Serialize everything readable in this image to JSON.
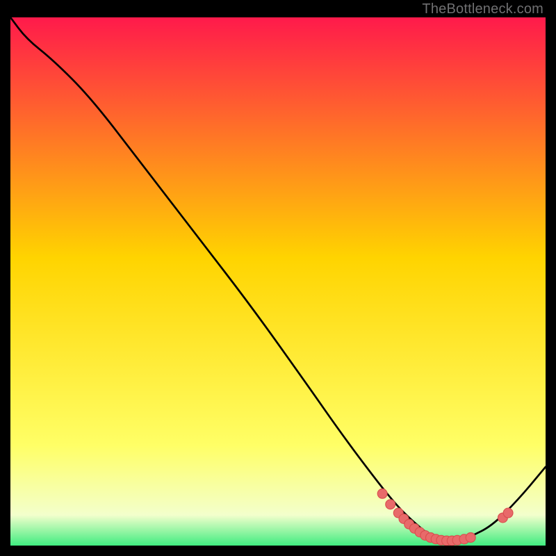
{
  "attribution": "TheBottleneck.com",
  "colors": {
    "frame": "#000000",
    "gradient_top": "#ff1a4b",
    "gradient_mid": "#ffd400",
    "gradient_low": "#ffff66",
    "gradient_pale": "#f3ffcc",
    "green": "#17e86f",
    "curve": "#000000",
    "dot_fill": "#e86a6a",
    "dot_stroke": "#d94f4f"
  },
  "chart_data": {
    "type": "line",
    "title": "",
    "xlabel": "",
    "ylabel": "",
    "xlim": [
      0,
      100
    ],
    "ylim": [
      0,
      100
    ],
    "notes": "Axes are unlabeled; x/y are normalized 0–100 to the visible plot area. Curve descends from top-left, bottoms out near x≈80, then rises toward the right edge. Red dots cluster along and around the trough.",
    "series": [
      {
        "name": "curve",
        "x": [
          0,
          3,
          8,
          15,
          25,
          35,
          45,
          55,
          62,
          68,
          72,
          75,
          78,
          80,
          82,
          84,
          86,
          90,
          95,
          100
        ],
        "values": [
          100,
          96,
          92,
          85,
          72,
          59,
          46,
          32,
          22,
          14,
          9,
          6,
          3.5,
          2.2,
          2.0,
          2.2,
          3.0,
          5,
          10,
          16
        ]
      },
      {
        "name": "dots",
        "x": [
          69.5,
          71.0,
          72.5,
          73.5,
          74.5,
          75.5,
          76.5,
          77.5,
          78.5,
          79.5,
          80.5,
          81.5,
          82.5,
          83.5,
          84.8,
          86.0,
          92.0,
          93.0
        ],
        "values": [
          11.0,
          9.0,
          7.4,
          6.3,
          5.3,
          4.5,
          3.8,
          3.2,
          2.8,
          2.5,
          2.3,
          2.2,
          2.2,
          2.3,
          2.5,
          2.8,
          6.5,
          7.4
        ]
      }
    ],
    "gradient_stops": [
      {
        "offset": 0.0,
        "key": "gradient_top"
      },
      {
        "offset": 0.45,
        "key": "gradient_mid"
      },
      {
        "offset": 0.8,
        "key": "gradient_low"
      },
      {
        "offset": 0.93,
        "key": "gradient_pale"
      },
      {
        "offset": 1.0,
        "key": "green"
      }
    ],
    "green_band_height_pct": 2.2
  }
}
